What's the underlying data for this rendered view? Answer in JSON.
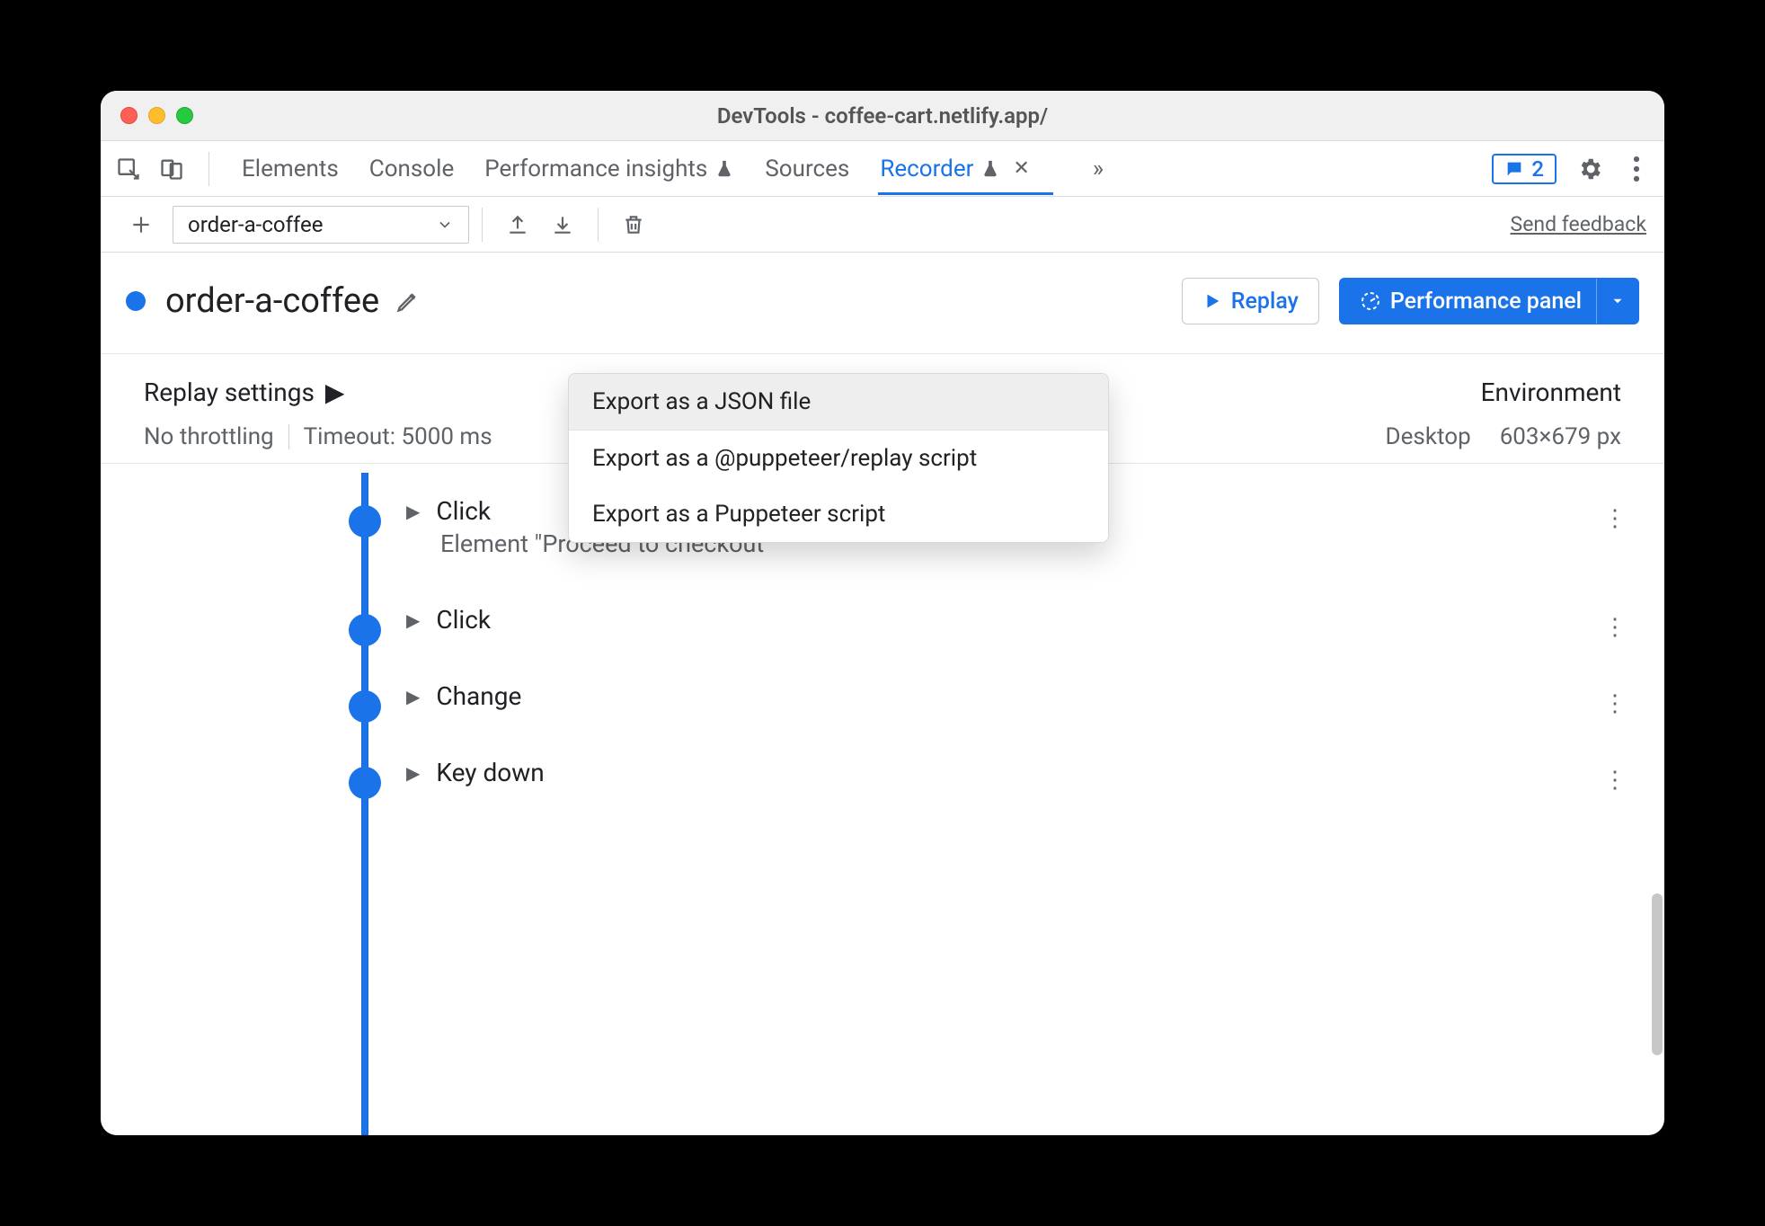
{
  "window": {
    "title": "DevTools - coffee-cart.netlify.app/"
  },
  "tabs": {
    "items": [
      {
        "label": "Elements"
      },
      {
        "label": "Console"
      },
      {
        "label": "Performance insights"
      },
      {
        "label": "Sources"
      },
      {
        "label": "Recorder"
      }
    ],
    "active_index": 4,
    "chat_count": "2"
  },
  "toolbar": {
    "recording_name": "order-a-coffee",
    "feedback_label": "Send feedback"
  },
  "export_menu": {
    "items": [
      "Export as a JSON file",
      "Export as a @puppeteer/replay script",
      "Export as a Puppeteer script"
    ],
    "highlighted_index": 0
  },
  "header": {
    "title": "order-a-coffee",
    "replay_label": "Replay",
    "perf_label": "Performance panel"
  },
  "settings": {
    "replay_settings_label": "Replay settings",
    "throttling": "No throttling",
    "timeout": "Timeout: 5000 ms",
    "env_label": "Environment",
    "device": "Desktop",
    "dimensions": "603×679 px"
  },
  "steps": [
    {
      "name": "Click",
      "sub": "Element \"Proceed to checkout\""
    },
    {
      "name": "Click",
      "sub": ""
    },
    {
      "name": "Change",
      "sub": ""
    },
    {
      "name": "Key down",
      "sub": ""
    }
  ]
}
